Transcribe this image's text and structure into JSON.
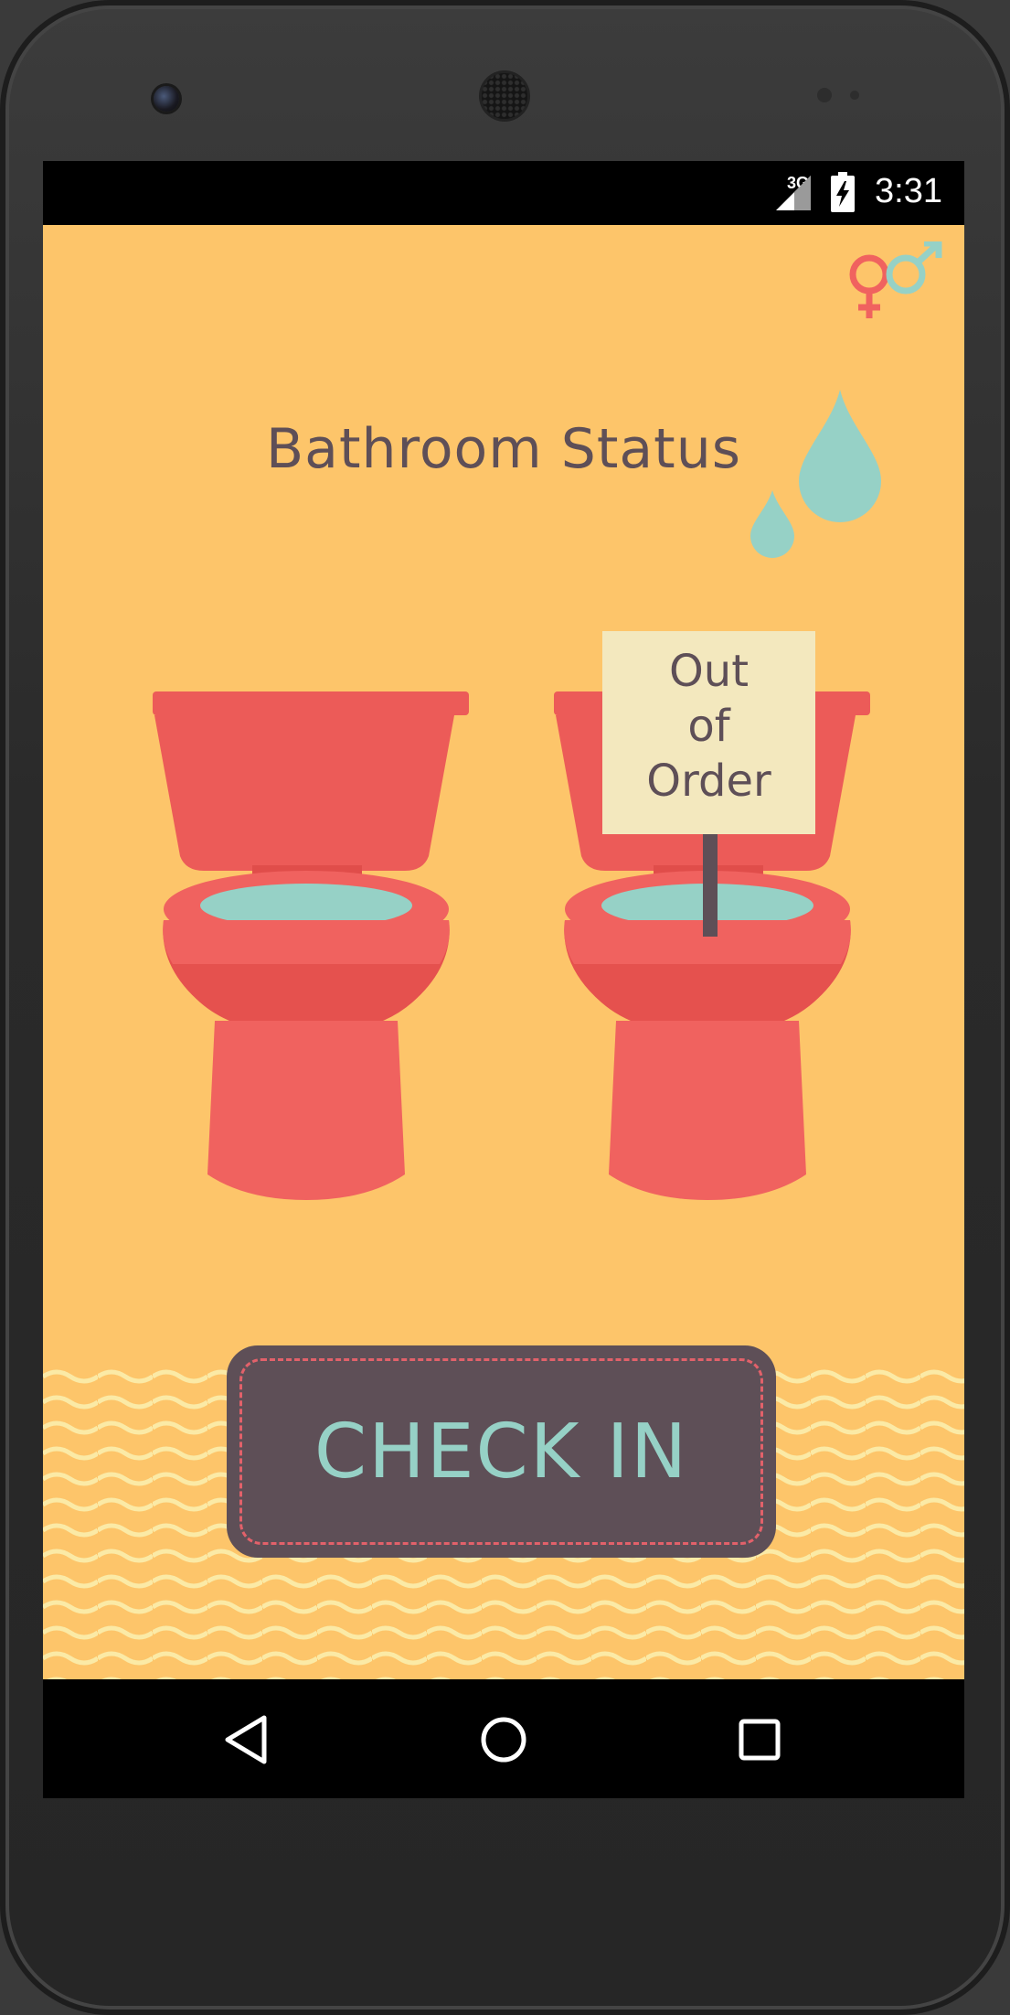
{
  "status_bar": {
    "network": "3G",
    "time": "3:31"
  },
  "app": {
    "title": "Bathroom Status",
    "sign_line_1": "Out",
    "sign_line_2": "of",
    "sign_line_3": "Order",
    "check_in_label": "CHECK IN"
  },
  "icons": {
    "gender": "female-male-icon",
    "drops": "water-drops-icon",
    "toilets": [
      "toilet-icon",
      "toilet-icon"
    ]
  },
  "nav_bar": {
    "back": "back-icon",
    "home": "home-icon",
    "recents": "recents-icon"
  },
  "colors": {
    "background": "#fdc56a",
    "text": "#5e4f57",
    "toilet": "#f0625f",
    "water": "#96d1c6",
    "sign": "#f3e8be",
    "button": "#5e4f57",
    "button_text": "#96d1c6",
    "button_dash": "#e2616a"
  }
}
